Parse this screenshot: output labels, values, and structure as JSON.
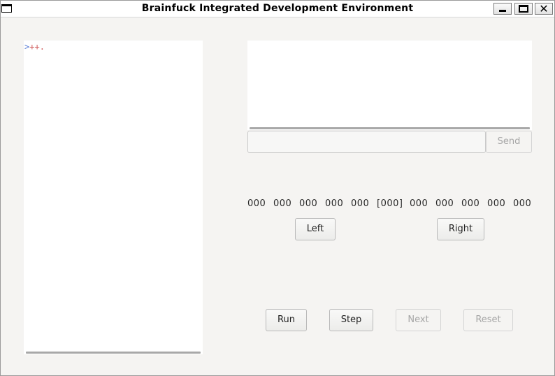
{
  "window": {
    "title": "Brainfuck Integrated Development Environment"
  },
  "editor": {
    "code_gt": ">",
    "code_plus": "++",
    "code_dot": "."
  },
  "output": {
    "text": ""
  },
  "input": {
    "value": "",
    "send_label": "Send"
  },
  "tape": {
    "cells": [
      "000",
      "000",
      "000",
      "000",
      "000",
      "[000]",
      "000",
      "000",
      "000",
      "000",
      "000"
    ],
    "left_label": "Left",
    "right_label": "Right"
  },
  "controls": {
    "run_label": "Run",
    "step_label": "Step",
    "next_label": "Next",
    "reset_label": "Reset"
  },
  "icons": {
    "window_menu": "window-menu-icon",
    "minimize": "minimize-icon",
    "maximize": "maximize-icon",
    "close": "close-icon"
  }
}
